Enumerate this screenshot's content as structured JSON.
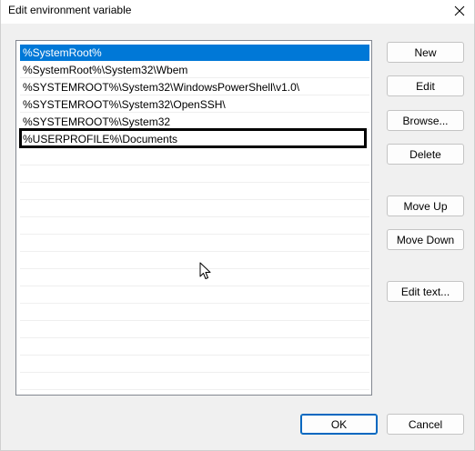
{
  "window": {
    "title": "Edit environment variable"
  },
  "list": {
    "items": [
      "%SystemRoot%",
      "%SystemRoot%\\System32\\Wbem",
      "%SYSTEMROOT%\\System32\\WindowsPowerShell\\v1.0\\",
      "%SYSTEMROOT%\\System32\\OpenSSH\\",
      "%SYSTEMROOT%\\System32",
      "%USERPROFILE%\\Documents"
    ],
    "selected_index": 0,
    "editing_index": 5
  },
  "buttons": {
    "new": "New",
    "edit": "Edit",
    "browse": "Browse...",
    "delete": "Delete",
    "move_up": "Move Up",
    "move_down": "Move Down",
    "edit_text": "Edit text...",
    "ok": "OK",
    "cancel": "Cancel"
  },
  "icons": {
    "close": "close-icon",
    "cursor": "mouse-pointer-icon"
  },
  "colors": {
    "selection": "#0078d7",
    "default_button_border": "#0067c0"
  }
}
